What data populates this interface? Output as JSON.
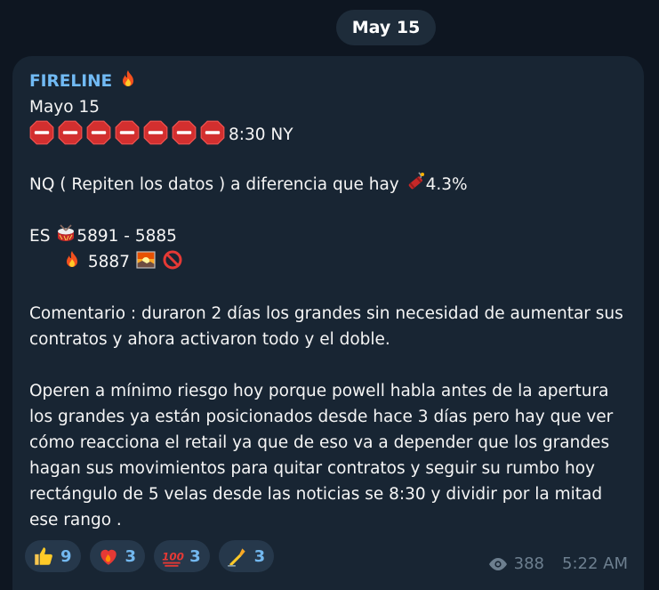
{
  "date_separator": "May 15",
  "message": {
    "sender": "FIRELINE",
    "sender_emoji": "fire-icon",
    "date_line": "Mayo 15",
    "time_line": "8:30 NY",
    "stop_icons_count": 7,
    "nq_line": "NQ ( Repiten los datos ) a diferencia que hay",
    "nq_value": "4.3%",
    "es_label": "ES",
    "es_range": "5891 - 5885",
    "es_level": "5887",
    "comment_1": "Comentario : duraron 2 días los grandes sin necesidad de aumentar sus contratos y ahora activaron todo y el doble.",
    "comment_2": "Operen a mínimo riesgo hoy porque powell habla antes de la apertura los grandes ya están posicionados desde hace 3 días pero hay que ver cómo reacciona el retail ya que de eso va a depender que los grandes hagan sus movimientos para quitar contratos y seguir su rumbo hoy rectángulo de 5 velas desde las noticias se 8:30 y dividir por la mitad ese rango ."
  },
  "reactions": [
    {
      "icon": "thumbs-up-icon",
      "count": "9"
    },
    {
      "icon": "heart-fire-icon",
      "count": "3"
    },
    {
      "icon": "hundred-icon",
      "count": "3"
    },
    {
      "icon": "writing-hand-icon",
      "count": "3"
    }
  ],
  "footer": {
    "views": "388",
    "time": "5:22 AM"
  },
  "colors": {
    "background": "#0e1621",
    "bubble": "#182533",
    "sender": "#71baf4",
    "reaction_bg": "#26384b",
    "reaction_count": "#73b8ef",
    "meta": "#6d7f8f"
  }
}
